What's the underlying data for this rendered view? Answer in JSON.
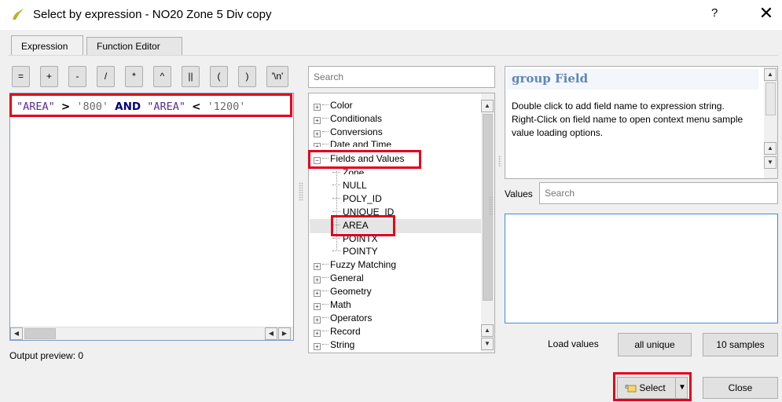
{
  "window": {
    "title": "Select by expression - NO20 Zone 5 Div copy",
    "help_label": "?",
    "close_label": "✕"
  },
  "tabs": [
    {
      "label": "Expression"
    },
    {
      "label": "Function Editor"
    }
  ],
  "operators": [
    "=",
    "+",
    "-",
    "/",
    "*",
    "^",
    "||",
    "(",
    ")",
    "'\\n'"
  ],
  "expression": {
    "field1": "\"AREA\"",
    "op1": ">",
    "val1": "'800'",
    "keyword": "AND",
    "field2": "\"AREA\"",
    "op2": "<",
    "val2": "'1200'"
  },
  "output_preview": "Output preview:  0",
  "search": {
    "placeholder": "Search"
  },
  "tree": {
    "groups_top": [
      "Color",
      "Conditionals",
      "Conversions",
      "Date and Time"
    ],
    "expanded_group": "Fields and Values",
    "fields": [
      "Zone",
      "NULL",
      "POLY_ID",
      "UNIQUE_ID",
      "AREA",
      "POINTX",
      "POINTY"
    ],
    "groups_bottom": [
      "Fuzzy Matching",
      "General",
      "Geometry",
      "Math",
      "Operators",
      "Record",
      "String"
    ]
  },
  "help": {
    "title": "group Field",
    "line1": "Double click to add field name to expression string.",
    "line2": "Right-Click on field name to open context menu sample value loading options."
  },
  "values": {
    "label": "Values",
    "placeholder": "Search"
  },
  "load_values": {
    "label": "Load values",
    "all_unique": "all unique",
    "samples": "10 samples"
  },
  "buttons": {
    "select": "Select",
    "close": "Close"
  },
  "colors": {
    "highlight": "#e3001b",
    "help_title": "#5e86b8"
  }
}
